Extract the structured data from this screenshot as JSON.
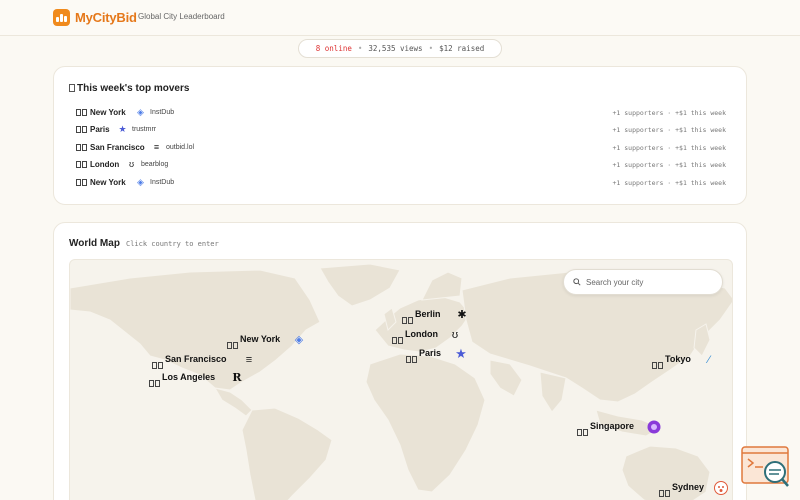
{
  "header": {
    "brand": "MyCityBid",
    "tagline": "Global City Leaderboard"
  },
  "stats": {
    "online": "8 online",
    "views": "32,535 views",
    "raised": "$12 raised",
    "separator": "•"
  },
  "movers": {
    "title": "This week's top movers",
    "rows": [
      {
        "city": "New York",
        "project": "InstDub",
        "project_icon": "instdub-diamond-icon",
        "meta": "+1 supporters · +$1 this week"
      },
      {
        "city": "Paris",
        "project": "trustmrr",
        "project_icon": "star-icon",
        "meta": "+1 supporters · +$1 this week"
      },
      {
        "city": "San Francisco",
        "project": "outbid.lol",
        "project_icon": "stripes-icon",
        "meta": "+1 supporters · +$1 this week"
      },
      {
        "city": "London",
        "project": "bearblog",
        "project_icon": "bear-face-icon",
        "meta": "+1 supporters · +$1 this week"
      },
      {
        "city": "New York",
        "project": "InstDub",
        "project_icon": "instdub-diamond-icon",
        "meta": "+1 supporters · +$1 this week"
      }
    ]
  },
  "map": {
    "title": "World Map",
    "hint": "Click country to enter",
    "search_placeholder": "Search your city",
    "pins": [
      {
        "city": "New York",
        "icon": "instdub-diamond-icon"
      },
      {
        "city": "San Francisco",
        "icon": "stripes-icon"
      },
      {
        "city": "Los Angeles",
        "icon": "letter-r-icon"
      },
      {
        "city": "Berlin",
        "icon": "sparkle-icon"
      },
      {
        "city": "London",
        "icon": "bear-face-icon"
      },
      {
        "city": "Paris",
        "icon": "star-icon"
      },
      {
        "city": "Tokyo",
        "icon": "slash-logo-icon"
      },
      {
        "city": "Singapore",
        "icon": "purple-orb-icon"
      },
      {
        "city": "Sydney",
        "icon": "emoji-face-icon"
      }
    ]
  },
  "colors": {
    "brand": "#e5781a",
    "online": "#d33333",
    "land": "#e9e3d6",
    "accent_star": "#4b5bd6",
    "accent_orb": "#8a3ad9"
  }
}
